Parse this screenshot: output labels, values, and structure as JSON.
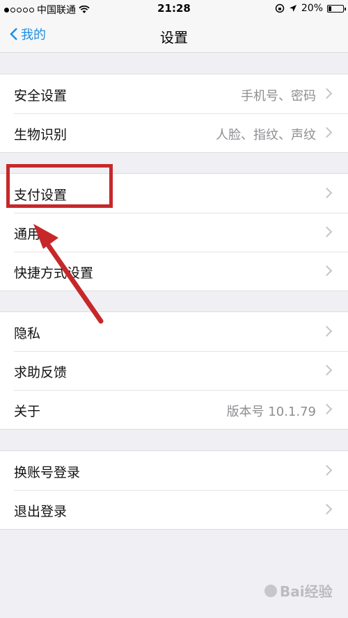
{
  "status_bar": {
    "carrier": "中国联通",
    "time": "21:28",
    "battery": "20%",
    "battery_level": 0.2
  },
  "nav": {
    "back_label": "我的",
    "title": "设置"
  },
  "groups": [
    {
      "rows": [
        {
          "label": "安全设置",
          "value": "手机号、密码"
        },
        {
          "label": "生物识别",
          "value": "人脸、指纹、声纹"
        }
      ]
    },
    {
      "rows": [
        {
          "label": "支付设置",
          "value": ""
        },
        {
          "label": "通用",
          "value": ""
        },
        {
          "label": "快捷方式设置",
          "value": ""
        }
      ]
    },
    {
      "rows": [
        {
          "label": "隐私",
          "value": ""
        },
        {
          "label": "求助反馈",
          "value": ""
        },
        {
          "label": "关于",
          "value": "版本号 10.1.79"
        }
      ]
    },
    {
      "rows": [
        {
          "label": "换账号登录",
          "value": ""
        },
        {
          "label": "退出登录",
          "value": ""
        }
      ]
    }
  ],
  "watermark": "Bai经验",
  "colors": {
    "accent": "#1b8fe5",
    "annotation": "#c6282a",
    "background": "#efeff4"
  }
}
